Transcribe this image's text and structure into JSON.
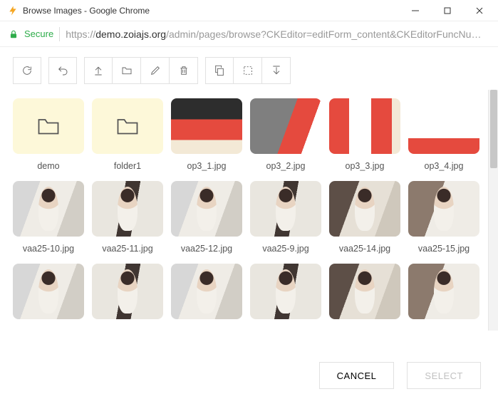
{
  "window": {
    "title": "Browse Images - Google Chrome",
    "secure_label": "Secure",
    "url_host": "demo.zoiajs.org",
    "url_scheme": "https://",
    "url_path": "/admin/pages/browse?CKEditor=editForm_content&CKEditorFuncNum=..."
  },
  "toolbar": {
    "refresh": "Refresh",
    "back": "Back",
    "upload": "Upload",
    "new_folder": "New folder",
    "rename": "Rename",
    "delete": "Delete",
    "copy": "Copy",
    "cut": "Cut",
    "paste": "Paste"
  },
  "items": [
    {
      "type": "folder",
      "label": "demo"
    },
    {
      "type": "folder",
      "label": "folder1"
    },
    {
      "type": "image",
      "label": "op3_1.jpg",
      "variant": "p0"
    },
    {
      "type": "image",
      "label": "op3_2.jpg",
      "variant": "p1"
    },
    {
      "type": "image",
      "label": "op3_3.jpg",
      "variant": "p2"
    },
    {
      "type": "image",
      "label": "op3_4.jpg",
      "variant": "p3"
    },
    {
      "type": "image",
      "label": "vaa25-10.jpg",
      "variant": "w"
    },
    {
      "type": "image",
      "label": "vaa25-11.jpg",
      "variant": "w2"
    },
    {
      "type": "image",
      "label": "vaa25-12.jpg",
      "variant": "w"
    },
    {
      "type": "image",
      "label": "vaa25-9.jpg",
      "variant": "w2"
    },
    {
      "type": "image",
      "label": "vaa25-14.jpg",
      "variant": "w3"
    },
    {
      "type": "image",
      "label": "vaa25-15.jpg",
      "variant": "w4"
    },
    {
      "type": "image",
      "label": "",
      "variant": "w"
    },
    {
      "type": "image",
      "label": "",
      "variant": "w2"
    },
    {
      "type": "image",
      "label": "",
      "variant": "w"
    },
    {
      "type": "image",
      "label": "",
      "variant": "w2"
    },
    {
      "type": "image",
      "label": "",
      "variant": "w3"
    },
    {
      "type": "image",
      "label": "",
      "variant": "w4"
    }
  ],
  "actions": {
    "cancel": "CANCEL",
    "select": "SELECT"
  }
}
